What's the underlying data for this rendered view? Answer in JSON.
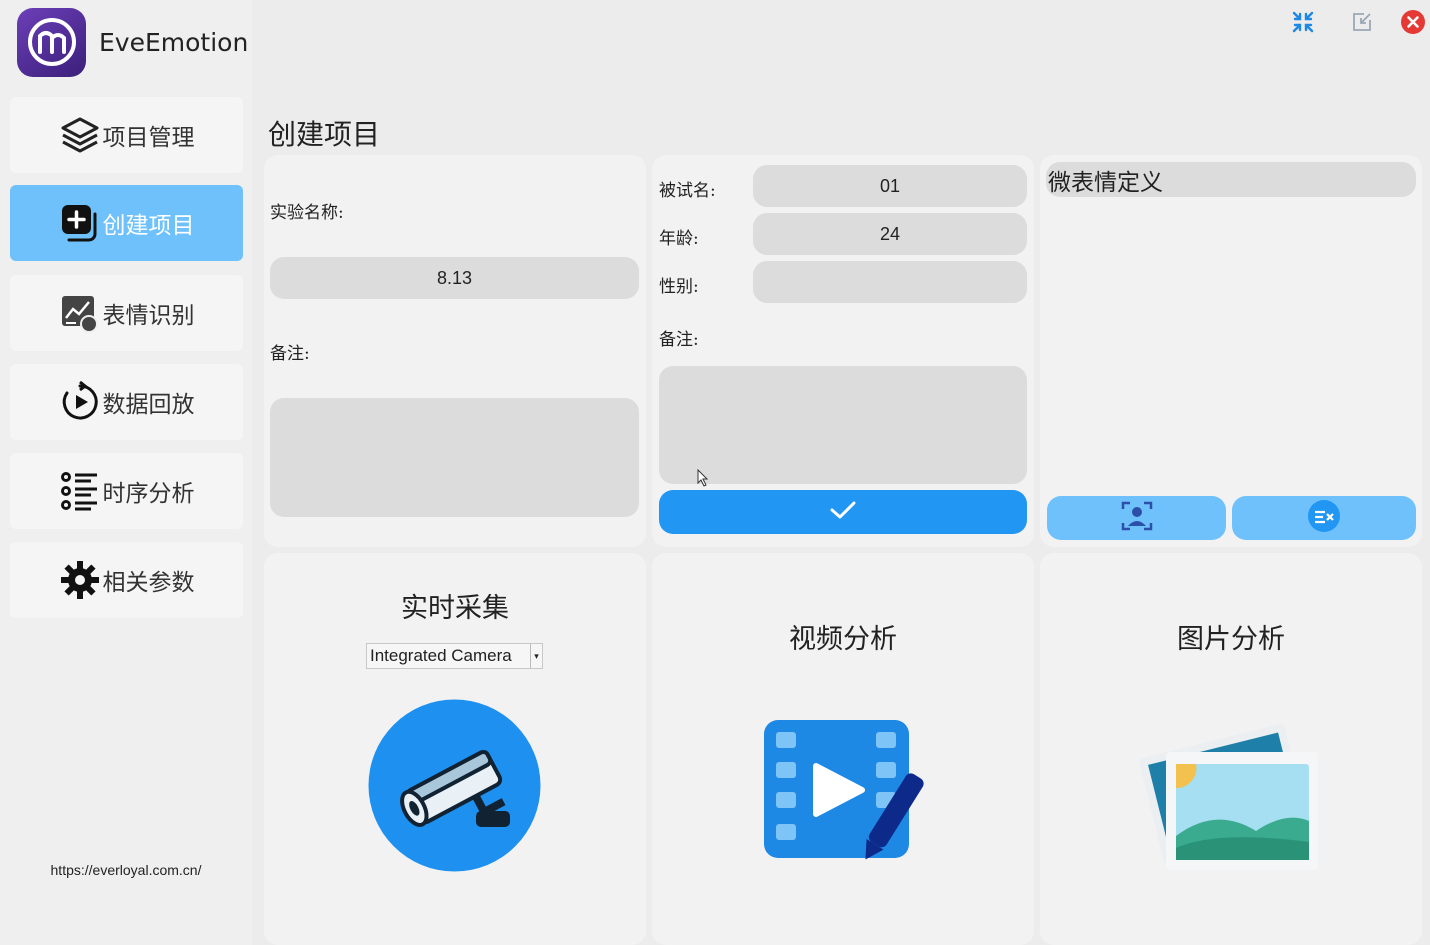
{
  "app": {
    "name": "EveEmotion",
    "url": "https://everloyal.com.cn/"
  },
  "sidebar": {
    "items": [
      {
        "label": "项目管理",
        "icon": "layers-icon"
      },
      {
        "label": "创建项目",
        "icon": "add-project-icon",
        "active": true
      },
      {
        "label": "表情识别",
        "icon": "chart-image-icon"
      },
      {
        "label": "数据回放",
        "icon": "replay-icon"
      },
      {
        "label": "时序分析",
        "icon": "list-icon"
      },
      {
        "label": "相关参数",
        "icon": "gear-icon"
      }
    ]
  },
  "window": {
    "controls": [
      "shrink-icon",
      "restore-icon",
      "close-icon"
    ]
  },
  "page": {
    "title": "创建项目"
  },
  "experiment": {
    "name_label": "实验名称:",
    "name_value": "8.13",
    "note_label": "备注:",
    "note_value": ""
  },
  "subject": {
    "name_label": "被试名:",
    "name_value": "01",
    "age_label": "年龄:",
    "age_value": "24",
    "gender_label": "性别:",
    "gender_value": "",
    "note_label": "备注:",
    "note_value": ""
  },
  "micro": {
    "title": "微表情定义"
  },
  "tiles": {
    "realtime": {
      "title": "实时采集",
      "camera": "Integrated Camera"
    },
    "video": {
      "title": "视频分析"
    },
    "image": {
      "title": "图片分析"
    }
  },
  "colors": {
    "accent": "#2196f3",
    "active": "#6fc1fb",
    "close": "#e53935"
  }
}
